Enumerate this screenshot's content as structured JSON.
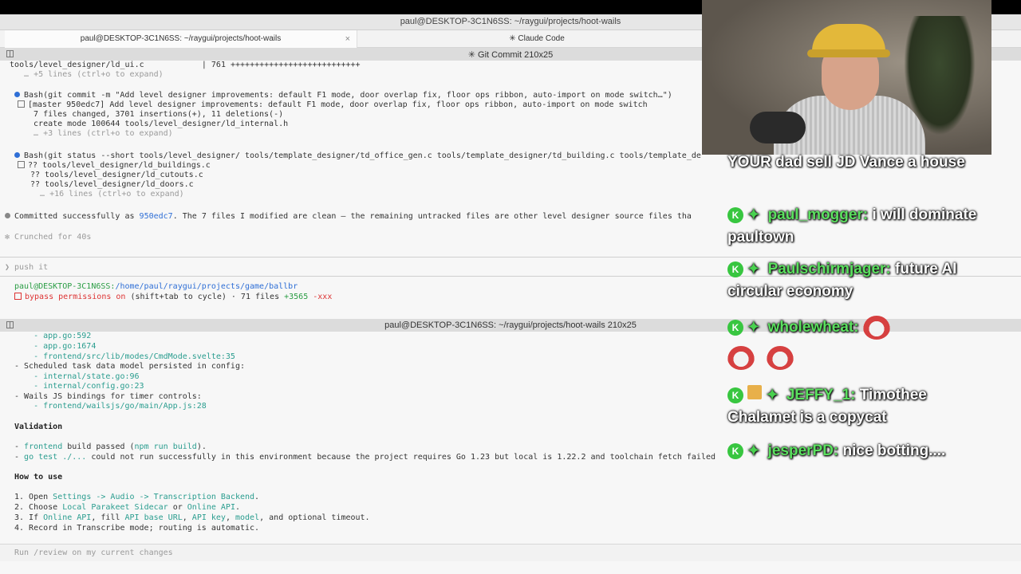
{
  "window": {
    "title": "paul@DESKTOP-3C1N6SS: ~/raygui/projects/hoot-wails"
  },
  "tabs": [
    {
      "label": "paul@DESKTOP-3C1N6SS: ~/raygui/projects/hoot-wails",
      "close": "×"
    },
    {
      "label": "✳ Claude Code"
    }
  ],
  "top_pane": {
    "title": "✳ Git Commit 210x25",
    "lines": [
      "  tools/level_designer/ld_ui.c            | 761 +++++++++++++++++++++++++++",
      "  … +5 lines (ctrl+o to expand)",
      "Bash(git commit -m \"Add level designer improvements: default F1 mode, door overlap fix, floor ops ribbon, auto-import on mode switch…\")",
      "[master 950edc7] Add level designer improvements: default F1 mode, door overlap fix, floor ops ribbon, auto-import on mode switch",
      "  7 files changed, 3701 insertions(+), 11 deletions(-)",
      "  create mode 100644 tools/level_designer/ld_internal.h",
      "  … +3 lines (ctrl+o to expand)",
      "Bash(git status --short tools/level_designer/ tools/template_designer/td_office_gen.c tools/template_designer/td_building.c tools/template_de",
      "?? tools/level_designer/ld_buildings.c",
      "?? tools/level_designer/ld_cutouts.c",
      "?? tools/level_designer/ld_doors.c",
      "  … +16 lines (ctrl+o to expand)",
      "Committed successfully as ",
      "950edc7",
      ". The 7 files I modified are clean — the remaining untracked files are other level designer source files tha",
      "✻ Crunched for 40s",
      "❯ push it",
      "paul@DESKTOP-3C1N6SS:",
      "/home/paul/raygui/projects/game/ballbr",
      "bypass permissions on",
      " (shift+tab to cycle) · 71 files ",
      "+3565",
      " -xxx"
    ]
  },
  "bottom_pane": {
    "title": "paul@DESKTOP-3C1N6SS: ~/raygui/projects/hoot-wails 210x25",
    "lines": [
      "    - app.go:592",
      "    - app.go:1674",
      "    - frontend/src/lib/modes/CmdMode.svelte:35",
      "- Scheduled task data model persisted in config:",
      "    - internal/state.go:96",
      "    - internal/config.go:23",
      "- Wails JS bindings for timer controls:",
      "    - frontend/wailsjs/go/main/App.js:28",
      "Validation",
      "- ",
      "frontend",
      " build passed (",
      "npm run build",
      ").",
      "- ",
      "go test ./...",
      " could not run successfully in this environment because the project requires Go 1.23 but local is 1.22.2 and toolchain fetch failed ",
      "How to use",
      "1. Open ",
      "Settings -> Audio -> Transcription Backend",
      ".",
      "2. Choose ",
      "Local Parakeet Sidecar",
      " or ",
      "Online API",
      ".",
      "3. If ",
      "Online API",
      ", fill ",
      "API base URL",
      ", ",
      "API key",
      ", ",
      "model",
      ", and optional timeout.",
      "4. Record in Transcribe mode; routing is automatic.",
      "Run /review on my current changes"
    ]
  },
  "chat": {
    "messages": [
      {
        "user": "",
        "text": "YOUR dad sell JD Vance a house"
      },
      {
        "user": "paul_mogger:",
        "text": "i will dominate paultown"
      },
      {
        "user": "Paulschirmjager:",
        "text": "future AI circular economy"
      },
      {
        "user": "wholewheat:",
        "text": ""
      },
      {
        "user": "JEFFY_1:",
        "text": "Timothee Chalamet is a copycat"
      },
      {
        "user": "jesperPD:",
        "text": "nice botting...."
      }
    ],
    "badge_letter": "K",
    "sparkle": "✦"
  },
  "colors": {
    "accent_blue": "#2f6fd6",
    "link_cyan": "#2a9d8f",
    "chat_user": "#5be05f"
  }
}
